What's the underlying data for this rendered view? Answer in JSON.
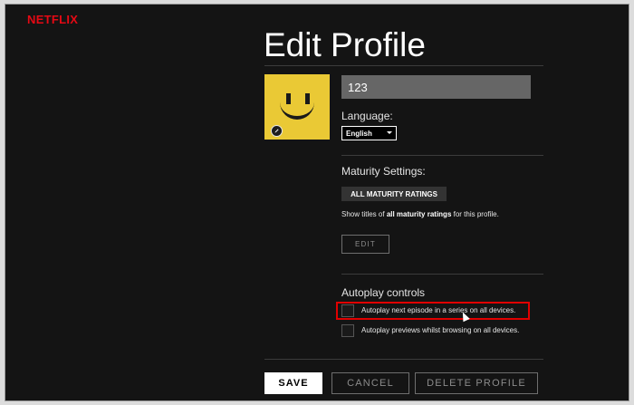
{
  "brand": {
    "logo_text": "NETFLIX"
  },
  "page": {
    "title": "Edit Profile"
  },
  "profile": {
    "name_value": "123"
  },
  "language": {
    "label": "Language:",
    "selected": "English"
  },
  "maturity": {
    "label": "Maturity Settings:",
    "badge": "ALL MATURITY RATINGS",
    "desc_prefix": "Show titles of ",
    "desc_bold": "all maturity ratings",
    "desc_suffix": " for this profile.",
    "edit_label": "EDIT"
  },
  "autoplay": {
    "label": "Autoplay controls",
    "option_1": "Autoplay next episode in a series on all devices.",
    "option_2": "Autoplay previews whilst browsing on all devices."
  },
  "actions": {
    "save": "SAVE",
    "cancel": "CANCEL",
    "delete": "DELETE PROFILE"
  },
  "colors": {
    "brand_red": "#e50914",
    "background": "#141414",
    "avatar_yellow": "#eac935",
    "highlight": "#e00000"
  }
}
